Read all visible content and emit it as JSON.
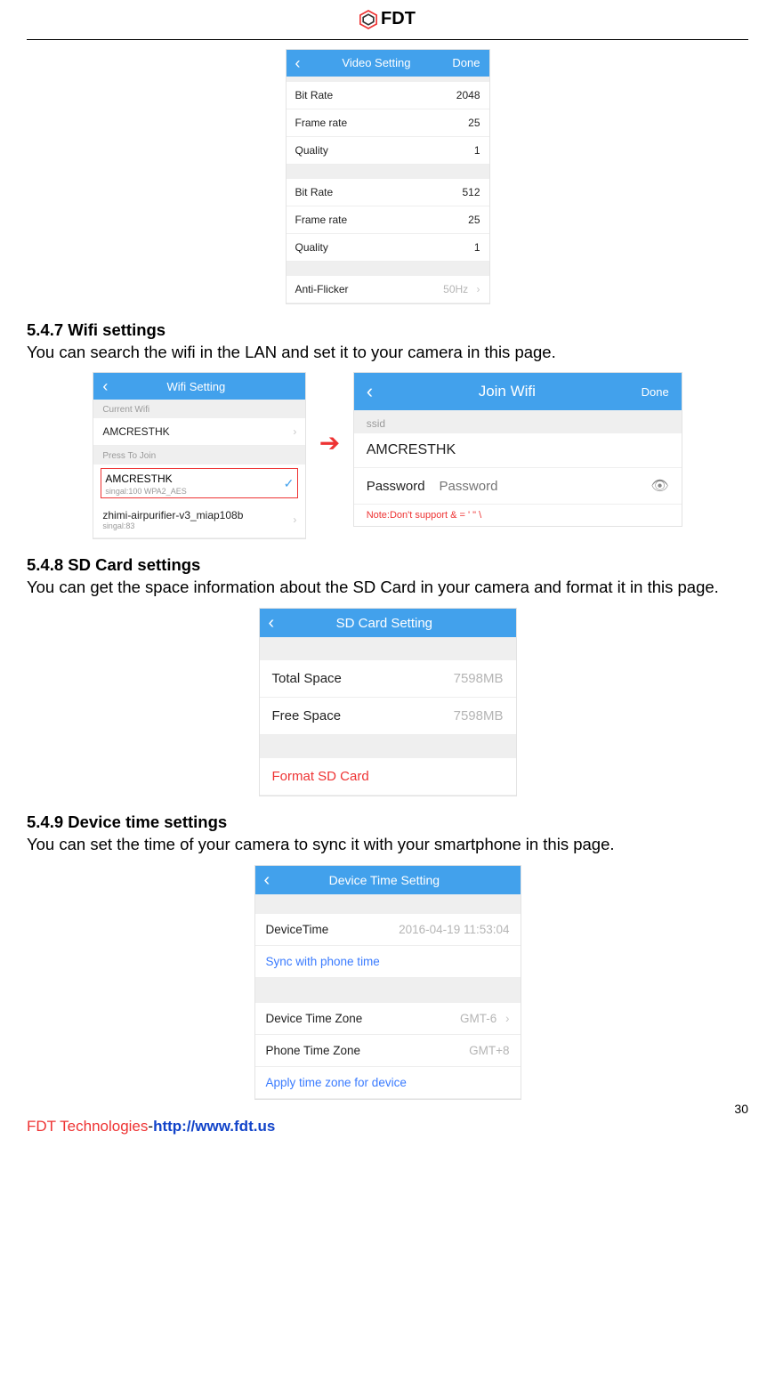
{
  "header": {
    "brand": "FDT"
  },
  "videoSetting": {
    "title": "Video Setting",
    "done": "Done",
    "group1": [
      {
        "label": "Bit Rate",
        "value": "2048"
      },
      {
        "label": "Frame rate",
        "value": "25"
      },
      {
        "label": "Quality",
        "value": "1"
      }
    ],
    "group2": [
      {
        "label": "Bit Rate",
        "value": "512"
      },
      {
        "label": "Frame rate",
        "value": "25"
      },
      {
        "label": "Quality",
        "value": "1"
      }
    ],
    "antiFlicker": {
      "label": "Anti-Flicker",
      "value": "50Hz"
    }
  },
  "sec547": {
    "title": "5.4.7 Wifi settings",
    "body": "You can search the wifi in the LAN and set it to your camera in this page."
  },
  "wifiSetting": {
    "title": "Wifi Setting",
    "currentLabel": "Current Wifi",
    "current": "AMCRESTHK",
    "pressLabel": "Press To Join",
    "sel": {
      "ssid": "AMCRESTHK",
      "meta": "singal:100   WPA2_AES"
    },
    "other": {
      "ssid": "zhimi-airpurifier-v3_miap108b",
      "meta": "singal:83"
    }
  },
  "joinWifi": {
    "title": "Join Wifi",
    "done": "Done",
    "ssidLabel": "ssid",
    "ssid": "AMCRESTHK",
    "pwdLabel": "Password",
    "pwdPlaceholder": "Password",
    "note": "Note:Don't support & = ' \" \\"
  },
  "sec548": {
    "title": "5.4.8 SD Card settings",
    "body": "You can get the space information about the SD Card in your camera and format it in this page."
  },
  "sdCard": {
    "title": "SD Card Setting",
    "total": {
      "label": "Total Space",
      "value": "7598MB"
    },
    "free": {
      "label": "Free Space",
      "value": "7598MB"
    },
    "format": "Format SD Card"
  },
  "sec549": {
    "title": "5.4.9 Device time settings",
    "body": "You can set the time of your camera to sync it with your smartphone in this page."
  },
  "deviceTime": {
    "title": "Device Time Setting",
    "device": {
      "label": "DeviceTime",
      "value": "2016-04-19  11:53:04"
    },
    "sync": "Sync with phone time",
    "devZone": {
      "label": "Device Time Zone",
      "value": "GMT-6"
    },
    "phoneZone": {
      "label": "Phone Time Zone",
      "value": "GMT+8"
    },
    "apply": "Apply time zone for device"
  },
  "pageNumber": "30",
  "footer": {
    "company": "FDT Technologies",
    "url": "http://www.fdt.us"
  }
}
